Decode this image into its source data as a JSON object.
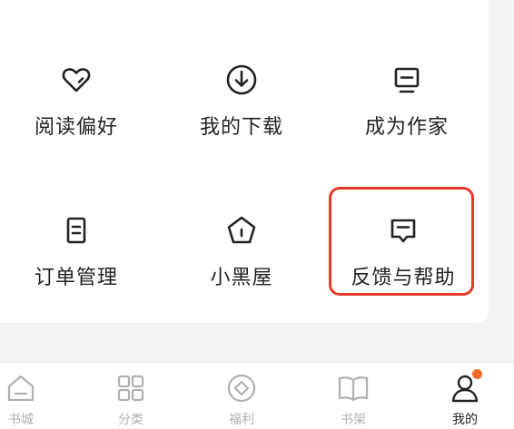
{
  "grid": {
    "items": [
      {
        "label": "阅读偏好",
        "icon": "heart-icon"
      },
      {
        "label": "我的下载",
        "icon": "download-icon"
      },
      {
        "label": "成为作家",
        "icon": "monitor-icon"
      },
      {
        "label": "订单管理",
        "icon": "document-icon"
      },
      {
        "label": "小黑屋",
        "icon": "pentagon-icon"
      },
      {
        "label": "反馈与帮助",
        "icon": "feedback-icon"
      }
    ]
  },
  "tabbar": {
    "items": [
      {
        "label": "书城",
        "icon": "home-icon",
        "active": false
      },
      {
        "label": "分类",
        "icon": "grid-icon",
        "active": false
      },
      {
        "label": "福利",
        "icon": "diamond-circle-icon",
        "active": false
      },
      {
        "label": "书架",
        "icon": "book-icon",
        "active": false
      },
      {
        "label": "我的",
        "icon": "user-icon",
        "active": true,
        "badge": true
      }
    ]
  },
  "colors": {
    "highlight": "#e8392b",
    "badge": "#f26b2a",
    "icon_dark": "#222222",
    "tab_inactive": "#b0b0b0"
  }
}
